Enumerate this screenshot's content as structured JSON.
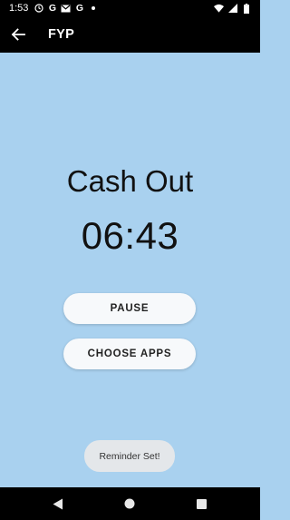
{
  "status_bar": {
    "time": "1:53",
    "google_letter_1": "G",
    "google_letter_2": "G",
    "icons": [
      "clock-icon",
      "google-icon",
      "gmail-icon",
      "google-icon",
      "notification-dot-icon",
      "wifi-icon",
      "signal-icon",
      "battery-icon"
    ]
  },
  "app_bar": {
    "title": "FYP",
    "back_icon": "arrow-left-icon"
  },
  "main": {
    "title": "Cash Out",
    "timer": "06:43",
    "pause_label": "PAUSE",
    "choose_apps_label": "CHOOSE APPS"
  },
  "toast": {
    "message": "Reminder Set!"
  },
  "nav_bar": {
    "icons": [
      "nav-back-icon",
      "nav-home-icon",
      "nav-recents-icon"
    ]
  },
  "colors": {
    "background": "#a9d1ef",
    "bars": "#000000",
    "button_bg": "#f7f9fb",
    "toast_bg": "#e4e7ea"
  }
}
